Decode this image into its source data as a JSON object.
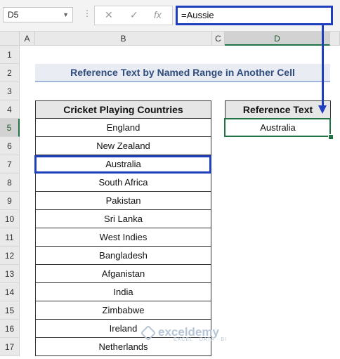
{
  "namebox": {
    "value": "D5"
  },
  "formula_bar": {
    "value": "=Aussie",
    "cancel_icon": "✕",
    "enter_icon": "✓",
    "fx_label": "fx"
  },
  "columns": [
    "A",
    "B",
    "C",
    "D"
  ],
  "rows": [
    "1",
    "2",
    "3",
    "4",
    "5",
    "6",
    "7",
    "8",
    "9",
    "10",
    "11",
    "12",
    "13",
    "14",
    "15",
    "16",
    "17"
  ],
  "sheet": {
    "title": "Reference Text by Named Range in Another Cell",
    "table_header": "Cricket Playing Countries",
    "countries": [
      "England",
      "New Zealand",
      "Australia",
      "South Africa",
      "Pakistan",
      "Sri Lanka",
      "West Indies",
      "Bangladesh",
      "Afganistan",
      "India",
      "Zimbabwe",
      "Ireland",
      "Netherlands"
    ],
    "ref_header": "Reference Text",
    "ref_value": "Australia"
  },
  "watermark": {
    "name": "exceldemy",
    "tagline": "EXCEL · DATA · BI"
  },
  "colors": {
    "accent_blue": "#1f3fbf",
    "excel_green": "#217346",
    "title_text": "#2f4d7e"
  }
}
